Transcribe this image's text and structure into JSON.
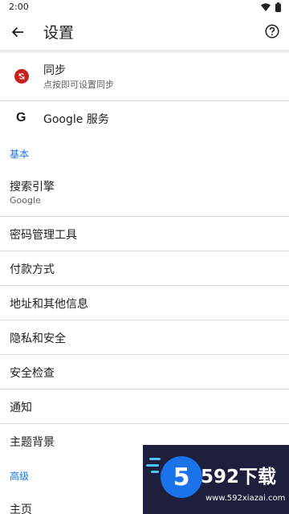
{
  "status_bar": {
    "time": "2:00",
    "icons": [
      "wifi-icon",
      "battery-icon"
    ]
  },
  "app_bar": {
    "back_icon": "arrow-left-icon",
    "title": "设置",
    "help_icon": "help-circle-icon"
  },
  "account": {
    "sync_title": "同步",
    "sync_subtitle": "点按即可设置同步",
    "sync_icon": "sync-off-icon",
    "google_services": "Google 服务",
    "google_icon": "google-g-icon"
  },
  "sections": {
    "basic": "基本",
    "advanced": "高级"
  },
  "basic_items": {
    "search_engine": "搜索引擎",
    "search_engine_value": "Google",
    "passwords": "密码管理工具",
    "payment": "付款方式",
    "addresses": "地址和其他信息",
    "privacy": "隐私和安全",
    "safety_check": "安全检查",
    "notifications": "通知",
    "theme": "主题背景"
  },
  "advanced_items": {
    "homepage": "主页"
  },
  "colors": {
    "accent": "#1a73e8",
    "sync_badge": "#c5221f",
    "divider": "#dadce0",
    "ad_background": "#1d1f3d"
  },
  "watermark": {
    "logo_glyph": "5",
    "brand": "592下载",
    "url": "www.592xiazai.com"
  }
}
